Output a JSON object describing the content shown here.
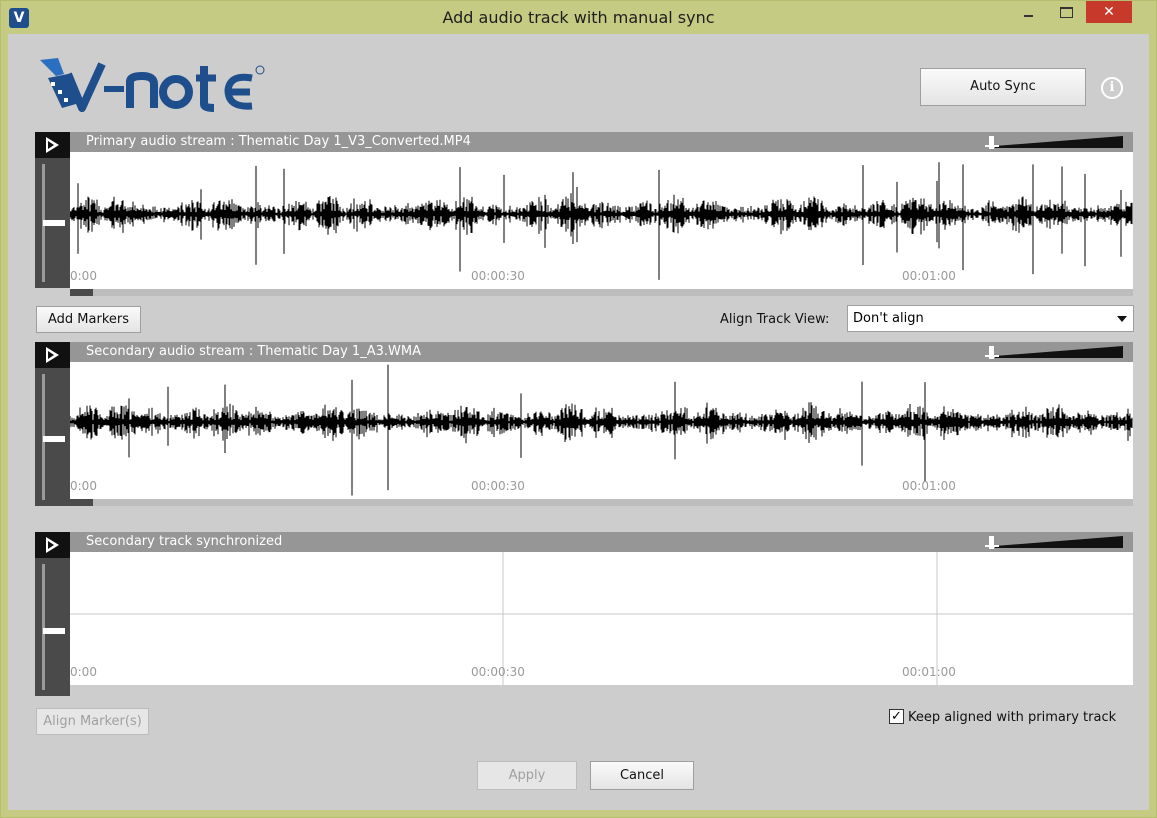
{
  "window": {
    "title": "Add audio track with manual sync",
    "app_icon": "V",
    "close_glyph": "✕"
  },
  "toolbar": {
    "auto_sync_label": "Auto Sync",
    "info_glyph": "i",
    "add_markers_label": "Add Markers",
    "align_track_view_label": "Align Track View:",
    "align_track_view_value": "Don't align"
  },
  "tracks": {
    "primary": {
      "title": "Primary audio stream : Thematic Day 1_V3_Converted.MP4",
      "ticks": [
        "0:00",
        "00:00:30",
        "00:01:00"
      ]
    },
    "secondary": {
      "title": "Secondary audio stream : Thematic Day 1_A3.WMA",
      "ticks": [
        "0:00",
        "00:00:30",
        "00:01:00"
      ]
    },
    "synchronized": {
      "title": "Secondary track synchronized",
      "ticks": [
        "0:00",
        "00:00:30",
        "00:01:00"
      ]
    }
  },
  "footer": {
    "align_markers_label": "Align Marker(s)",
    "keep_aligned_label": "Keep aligned with primary track",
    "keep_aligned_checked": true,
    "check_glyph": "✓",
    "apply_label": "Apply",
    "cancel_label": "Cancel"
  },
  "colors": {
    "frame": "#c5cb82",
    "client_bg": "#cdcdcd",
    "close_button": "#c73a2b",
    "logo_blue": "#1e4f8c"
  }
}
